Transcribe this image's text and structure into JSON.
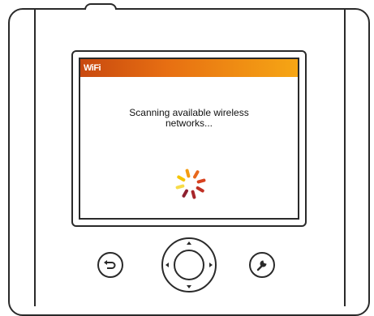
{
  "screen": {
    "title": "WiFi",
    "message_line1": "Scanning available wireless",
    "message_line2": "networks...",
    "title_bar_colors": [
      "#c8490f",
      "#e76f12",
      "#f6a614"
    ],
    "spinner_colors": [
      "#f5c400",
      "#f39c12",
      "#e8681c",
      "#d8421f",
      "#c03024",
      "#a8262b",
      "#8e2030",
      "#f7dc4a"
    ]
  },
  "buttons": {
    "back": {
      "icon": "back-arrow-icon"
    },
    "settings": {
      "icon": "wrench-icon"
    },
    "dpad": {
      "icon": "dpad-icon"
    }
  }
}
